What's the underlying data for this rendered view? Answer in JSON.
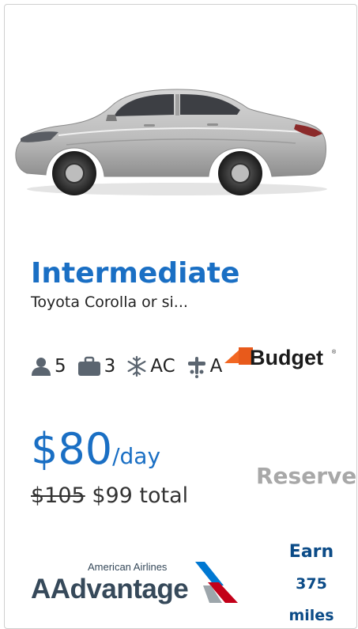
{
  "vehicle": {
    "class_name": "Intermediate",
    "model": "Toyota Corolla or si...",
    "features": {
      "passengers": "5",
      "bags": "3",
      "ac": "AC",
      "transmission": "A"
    },
    "icons": [
      "person-icon",
      "suitcase-icon",
      "snowflake-icon",
      "gear-shift-icon"
    ]
  },
  "vendor": {
    "name": "Budget",
    "brand_color": "#1a1a1a",
    "accent_color": "#f26722"
  },
  "pricing": {
    "daily_amount": "$80",
    "daily_unit": "/day",
    "original_total": "$105",
    "total": "$99 total"
  },
  "actions": {
    "reserve_label": "Reserve"
  },
  "loyalty": {
    "brand_small": "American Airlines",
    "brand_large": "AAdvantage",
    "earn_label": "Earn",
    "miles_value": "375",
    "miles_unit": "miles"
  },
  "colors": {
    "primary_blue": "#1a6fc4",
    "loyalty_navy": "#0b4b87",
    "reserve_disabled": "#a8a8a8",
    "text": "#222222"
  }
}
